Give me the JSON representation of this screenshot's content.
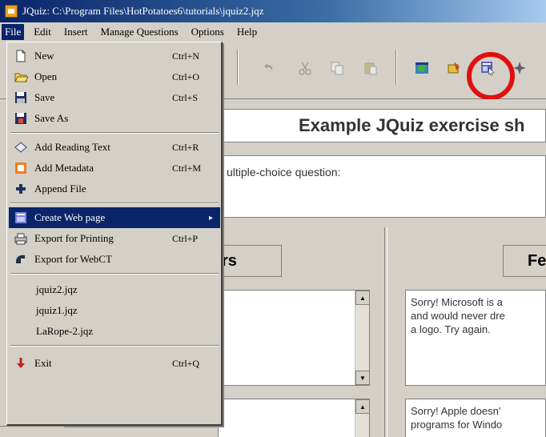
{
  "window": {
    "title": "JQuiz: C:\\Program Files\\HotPotatoes6\\tutorials\\jquiz2.jqz"
  },
  "menubar": {
    "items": [
      "File",
      "Edit",
      "Insert",
      "Manage Questions",
      "Options",
      "Help"
    ]
  },
  "toolbar": {
    "icons": [
      "undo-icon",
      "cut-icon",
      "copy-icon",
      "paste-icon",
      "web-icon",
      "config-icon",
      "create-webpage-icon",
      "settings-icon"
    ]
  },
  "editor": {
    "title_text": "Example JQuiz exercise sh",
    "question_text": "ultiple-choice question:",
    "answers_header": "rs",
    "feedback_header": "Fe",
    "feedback_1": "Sorry! Microsoft is a\nand would never dre\na logo. Try again.",
    "feedback_2": "Sorry! Apple doesn'\nprograms for Windo"
  },
  "file_menu": {
    "items": [
      {
        "label": "New",
        "shortcut": "Ctrl+N",
        "icon": "new-file-icon"
      },
      {
        "label": "Open",
        "shortcut": "Ctrl+O",
        "icon": "open-folder-icon"
      },
      {
        "label": "Save",
        "shortcut": "Ctrl+S",
        "icon": "save-disk-icon"
      },
      {
        "label": "Save As",
        "shortcut": "",
        "icon": "save-as-icon"
      },
      {
        "label": "Add Reading Text",
        "shortcut": "Ctrl+R",
        "icon": "reading-text-icon"
      },
      {
        "label": "Add Metadata",
        "shortcut": "Ctrl+M",
        "icon": "metadata-icon"
      },
      {
        "label": "Append File",
        "shortcut": "",
        "icon": "append-file-icon"
      },
      {
        "label": "Create Web page",
        "shortcut": "",
        "icon": "create-webpage-icon",
        "submenu": "▸"
      },
      {
        "label": "Export for Printing",
        "shortcut": "Ctrl+P",
        "icon": "print-icon"
      },
      {
        "label": "Export for WebCT",
        "shortcut": "",
        "icon": "webct-icon"
      },
      {
        "label": "jquiz2.jqz",
        "shortcut": ""
      },
      {
        "label": "jquiz1.jqz",
        "shortcut": ""
      },
      {
        "label": "LaRope-2.jqz",
        "shortcut": ""
      },
      {
        "label": "Exit",
        "shortcut": "Ctrl+Q",
        "icon": "exit-icon"
      }
    ]
  },
  "colors": {
    "highlight": "#0a246a",
    "annotation_circle": "#e01010",
    "title_bar": "#0a246a"
  }
}
